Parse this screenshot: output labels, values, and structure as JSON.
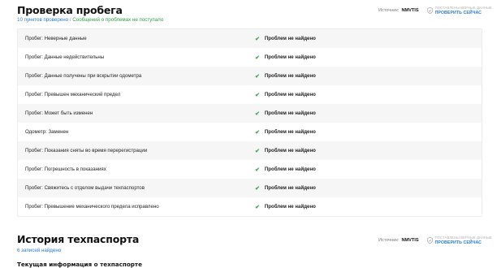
{
  "mileage": {
    "title": "Проверка пробега",
    "summary_checked": "10 пунктов проверено",
    "summary_sep": "/",
    "summary_status": "Сообщений о проблемах не поступало",
    "source_label": "Источник:",
    "source_name": "NMVTIS",
    "verify_small": "ПОСТАВЛЕНЫ ВЕРНЫЕ ДАННЫЕ",
    "verify_link": "ПРОВЕРИТЬ СЕЙЧАС",
    "result_text": "Проблем не найдено",
    "rows": [
      "Пробег: Неверные данные",
      "Пробег: Данные недействительны",
      "Пробег: Данные получены при вскрытии одометра",
      "Пробег: Превышен механический предел",
      "Пробег: Может быть изменен",
      "Одометр: Заменен",
      "Пробег: Показания сняты во время перерегистрации",
      "Пробег: Погрешность в показаниях",
      "Пробег: Свяжитесь с отделом выдачи техпаспортов",
      "Пробег: Превышение механического предела исправлено"
    ]
  },
  "title_history": {
    "title": "История техпаспорта",
    "summary": "6 записей найдено",
    "source_label": "Источник:",
    "source_name": "NMVTIS",
    "verify_small": "ПОСТАВЛЕНЫ ВЕРНЫЕ ДАННЫЕ",
    "verify_link": "ПРОВЕРИТЬ СЕЙЧАС",
    "current_info_title": "Текущая информация о техпаспорте"
  },
  "icons": {
    "check": "check-icon",
    "shield": "shield-icon"
  },
  "colors": {
    "link_blue": "#2b7cd3",
    "ok_green": "#2f9e44",
    "row_alt": "#f6f6f7"
  }
}
